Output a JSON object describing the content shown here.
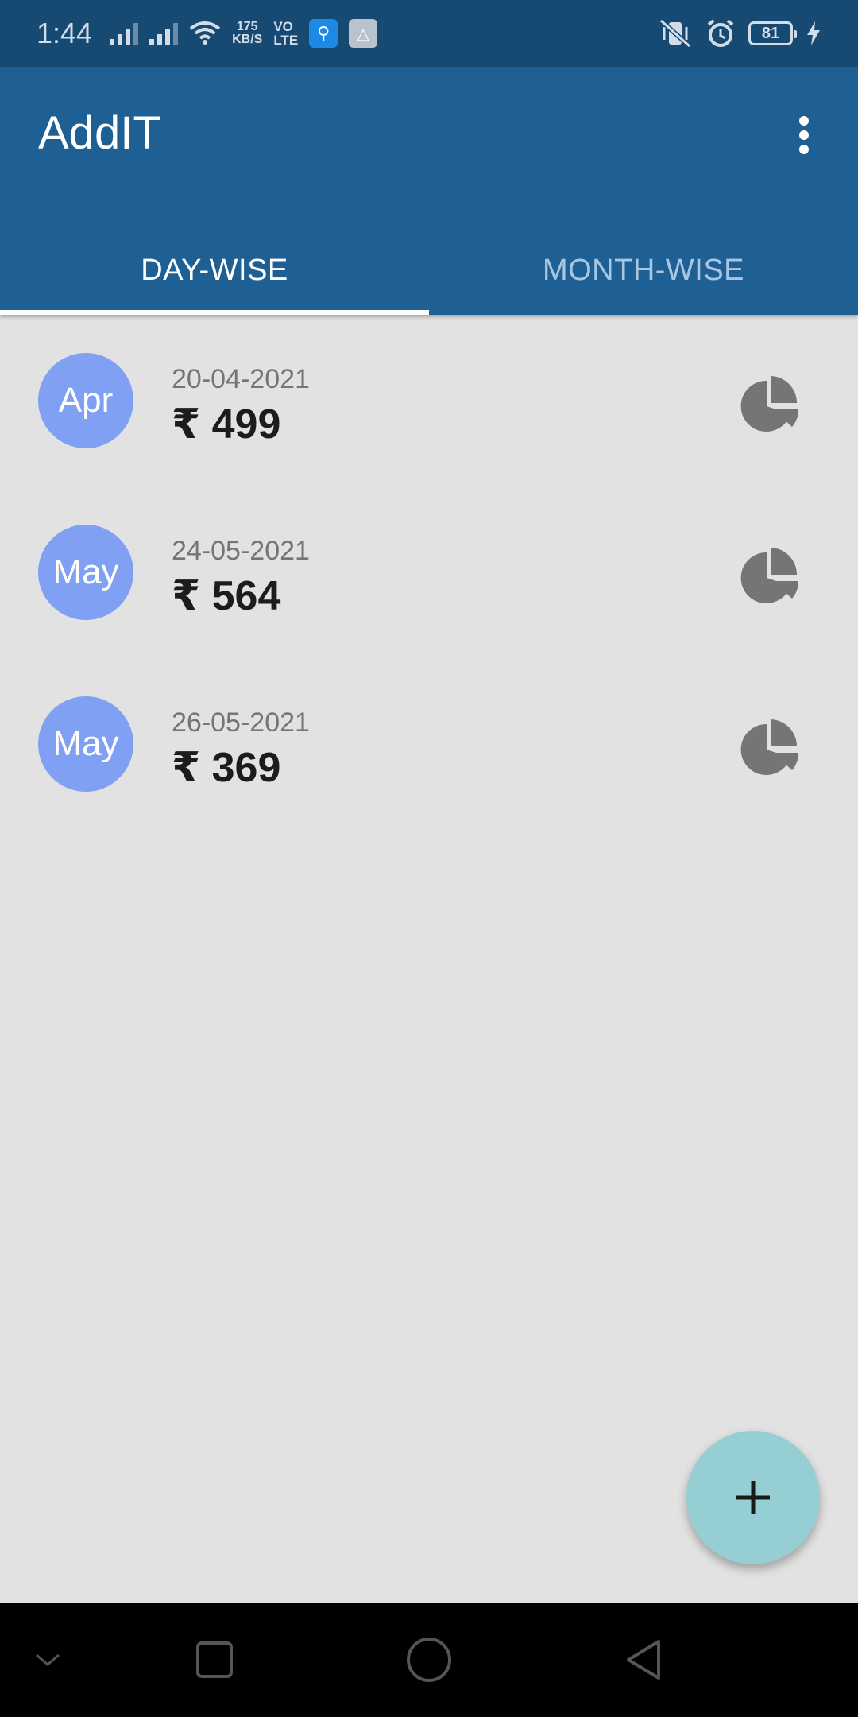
{
  "status_bar": {
    "time": "1:44",
    "speed_value": "175",
    "speed_unit": "KB/S",
    "volte_line1": "VO",
    "volte_line2": "LTE",
    "battery_level": "81"
  },
  "app": {
    "title": "AddIT"
  },
  "tabs": [
    {
      "label": "DAY-WISE",
      "active": true
    },
    {
      "label": "MONTH-WISE",
      "active": false
    }
  ],
  "entries": [
    {
      "month": "Apr",
      "date": "20-04-2021",
      "amount": "₹ 499"
    },
    {
      "month": "May",
      "date": "24-05-2021",
      "amount": "₹ 564"
    },
    {
      "month": "May",
      "date": "26-05-2021",
      "amount": "₹ 369"
    }
  ],
  "fab": {
    "icon": "plus-icon"
  },
  "colors": {
    "status_bar": "#174a73",
    "app_bar": "#1f6094",
    "avatar": "#80a0f3",
    "fab": "#95cfd3",
    "background": "#e2e2e2"
  }
}
